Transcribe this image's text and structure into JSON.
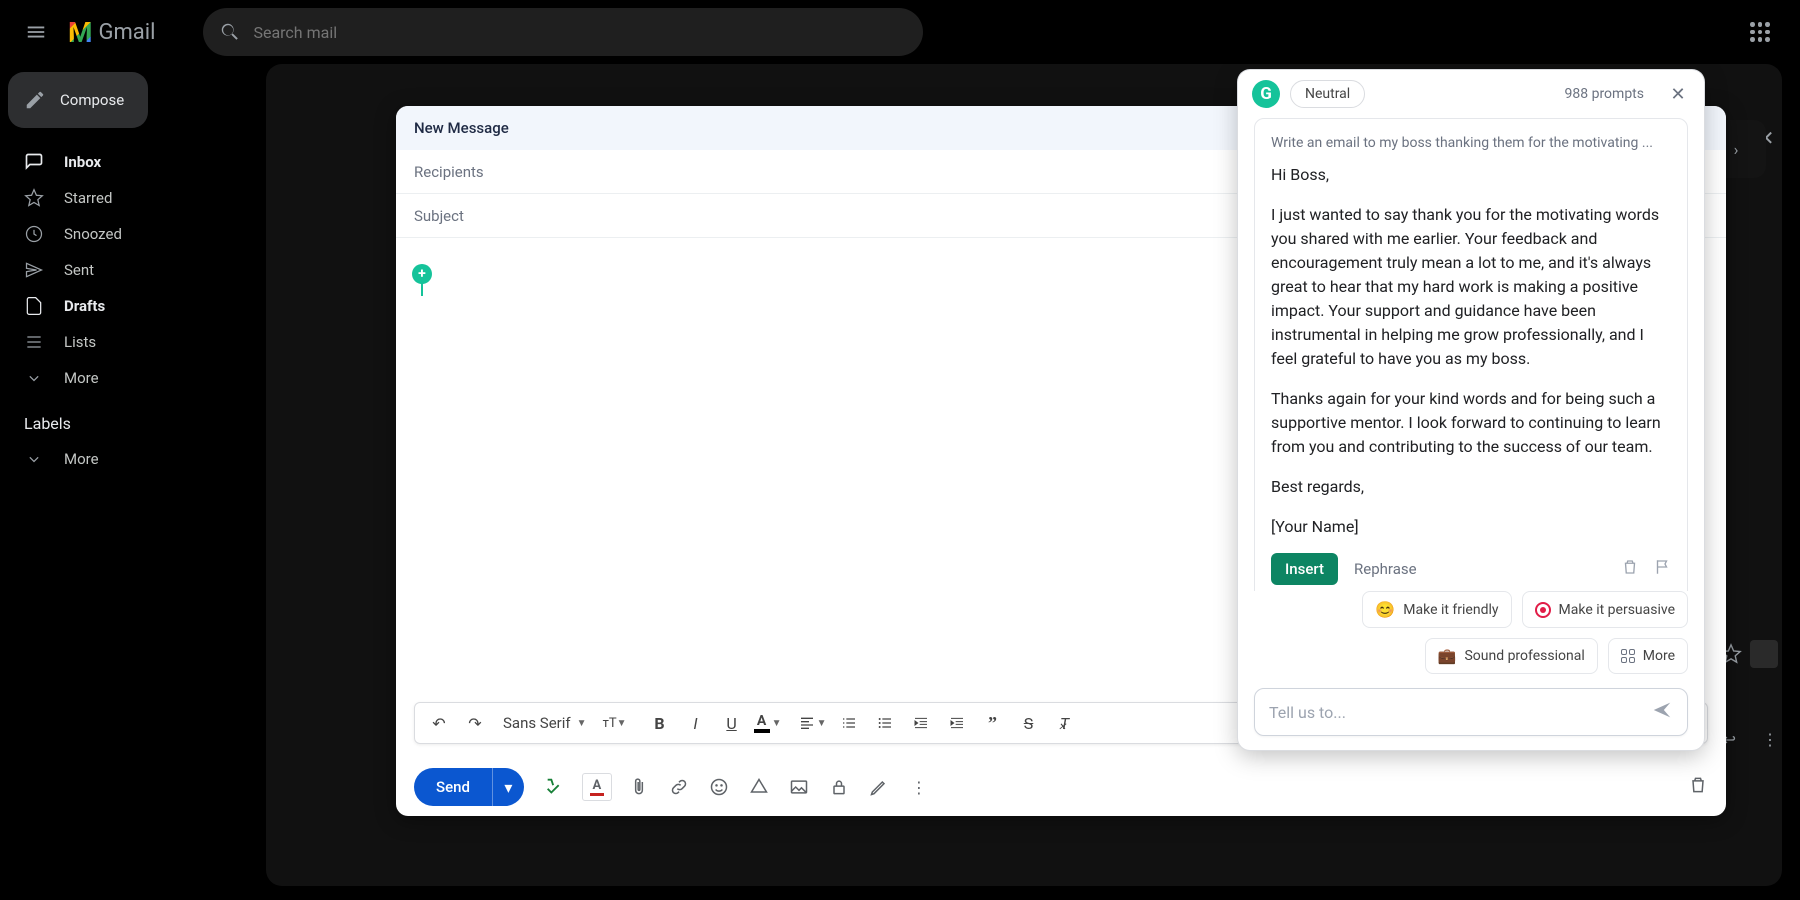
{
  "app": {
    "name": "Gmail"
  },
  "search": {
    "placeholder": "Search mail"
  },
  "compose_button": "Compose",
  "nav": {
    "inbox": "Inbox",
    "starred": "Starred",
    "snoozed": "Snoozed",
    "sent": "Sent",
    "drafts": "Drafts",
    "lists": "Lists",
    "more": "More"
  },
  "labels_header": "Labels",
  "labels_more": "More",
  "compose_window": {
    "title": "New Message",
    "recipients_placeholder": "Recipients",
    "subject_placeholder": "Subject",
    "font_name": "Sans Serif",
    "send_label": "Send"
  },
  "grammarly": {
    "tone": "Neutral",
    "prompts_remaining": "988 prompts",
    "prompt_preview": "Write an email to my boss thanking them for the motivating ...",
    "greeting": "Hi Boss,",
    "para1": "I just wanted to say thank you for the motivating words you shared with me earlier. Your feedback and encouragement truly mean a lot to me, and it's always great to hear that my hard work is making a positive impact. Your support and guidance have been instrumental in helping me grow professionally, and I feel grateful to have you as my boss.",
    "para2": "Thanks again for your kind words and for being such a supportive mentor. I look forward to continuing to learn from you and contributing to the success of our team.",
    "signoff": "Best regards,",
    "signature": "[Your Name]",
    "insert_label": "Insert",
    "rephrase_label": "Rephrase",
    "suggestions": {
      "friendly": "Make it friendly",
      "persuasive": "Make it persuasive",
      "professional": "Sound professional",
      "more": "More"
    },
    "input_placeholder": "Tell us to..."
  }
}
